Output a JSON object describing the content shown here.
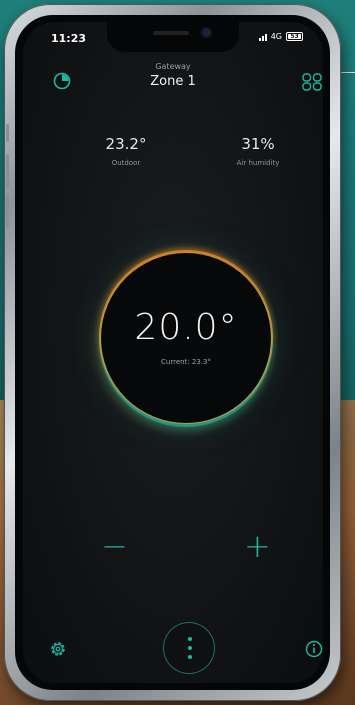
{
  "status_bar": {
    "time": "11:23",
    "network": "4G",
    "battery": "53"
  },
  "header": {
    "gateway_label": "Gateway",
    "zone_title": "Zone 1"
  },
  "stats": {
    "outdoor": {
      "value": "23.2°",
      "label": "Outdoor"
    },
    "humidity": {
      "value": "31%",
      "label": "Air humidity"
    }
  },
  "thermostat": {
    "setpoint": "20.0°",
    "current": "Current: 23.3°"
  },
  "controls": {
    "decrease": "−",
    "increase": "+"
  },
  "icons": {
    "top_left": "clock-icon",
    "top_right": "grid-icon",
    "bottom_left": "settings-icon",
    "bottom_center": "more-vertical-icon",
    "bottom_right": "info-icon"
  },
  "colors": {
    "accent": "#1fb8a0",
    "warm_glow": "#ff9a2e",
    "background": "#121416"
  }
}
